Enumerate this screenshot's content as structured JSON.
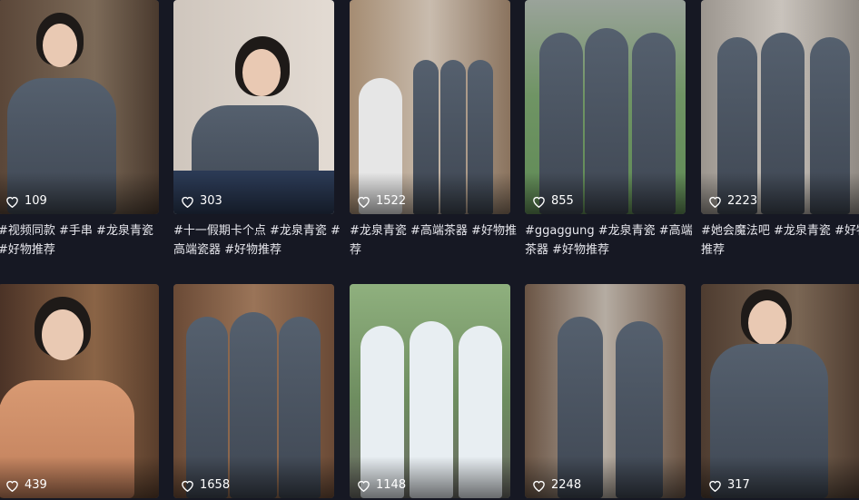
{
  "videos": [
    {
      "likes": "109",
      "caption": "#视频同款 #手串 #龙泉青瓷 #好物推荐",
      "bg": "#6b5a4a"
    },
    {
      "likes": "303",
      "caption": "#十一假期卡个点 #龙泉青瓷 #高端瓷器 #好物推荐",
      "bg": "#d8cfc6"
    },
    {
      "likes": "1522",
      "caption": "#龙泉青瓷 #高端茶器 #好物推荐",
      "bg": "#8a7868"
    },
    {
      "likes": "855",
      "caption": "#ggaggung #龙泉青瓷 #高端茶器 #好物推荐",
      "bg": "#5f7d5a"
    },
    {
      "likes": "2223",
      "caption": "#她会魔法吧 #龙泉青瓷 #好物推荐",
      "bg": "#b6b0aa"
    },
    {
      "likes": "439",
      "caption": "",
      "bg": "#6e4b36"
    },
    {
      "likes": "1658",
      "caption": "",
      "bg": "#7a5a44"
    },
    {
      "likes": "1148",
      "caption": "",
      "bg": "#6f8c63"
    },
    {
      "likes": "2248",
      "caption": "",
      "bg": "#8c8075"
    },
    {
      "likes": "317",
      "caption": "",
      "bg": "#5c4a3c"
    }
  ],
  "icons": {
    "like": "heart-icon"
  },
  "colors": {
    "page_bg": "#161823",
    "text": "#e8e8ee"
  }
}
